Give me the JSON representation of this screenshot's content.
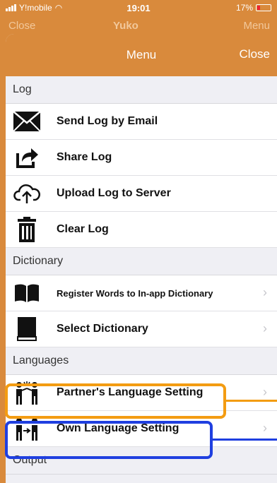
{
  "status": {
    "carrier": "Y!mobile",
    "time": "19:01",
    "battery": "17%"
  },
  "behind": {
    "left": "Close",
    "middle": "Yuko",
    "right": "Menu"
  },
  "header": {
    "title": "Menu",
    "close_label": "Close"
  },
  "sections": {
    "log": {
      "title": "Log",
      "items": [
        "Send Log by Email",
        "Share Log",
        "Upload Log to Server",
        "Clear Log"
      ]
    },
    "dictionary": {
      "title": "Dictionary",
      "items": [
        "Register Words to In-app Dictionary",
        "Select Dictionary"
      ]
    },
    "languages": {
      "title": "Languages",
      "items": [
        "Partner's Language Setting",
        "Own Language Setting"
      ]
    },
    "output": {
      "title": "Output"
    }
  },
  "colors": {
    "accent": "#d98a3c",
    "highlight_orange": "#f39c12",
    "highlight_blue": "#1f3fe0"
  }
}
